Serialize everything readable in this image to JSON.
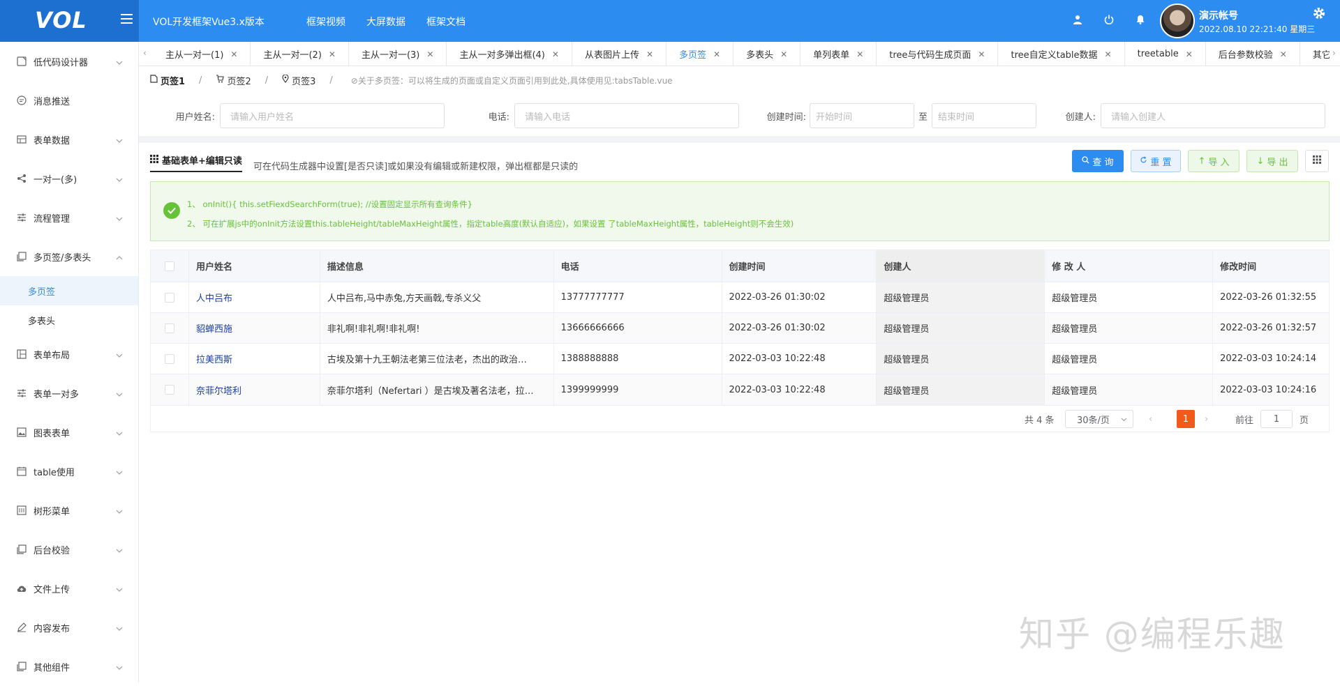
{
  "header": {
    "logo": "VOL",
    "app_title": "VOL开发框架Vue3.x版本",
    "nav": [
      "框架视频",
      "大屏数据",
      "框架文档"
    ],
    "user_name": "演示帐号",
    "user_date": "2022.08.10 22:21:40 星期三",
    "colors": {
      "primary": "#2d8cf0",
      "logo_bg": "#1d6fd0"
    }
  },
  "sidebar": {
    "items": [
      {
        "label": "低代码设计器",
        "icon": "form-icon"
      },
      {
        "label": "消息推送",
        "icon": "message-icon"
      },
      {
        "label": "表单数据",
        "icon": "table-icon"
      },
      {
        "label": "一对一(多)",
        "icon": "share-icon"
      },
      {
        "label": "流程管理",
        "icon": "sliders-icon"
      },
      {
        "label": "多页签/多表头",
        "icon": "copy-icon",
        "expanded": true,
        "children": [
          {
            "label": "多页签",
            "active": true
          },
          {
            "label": "多表头"
          }
        ]
      },
      {
        "label": "表单布局",
        "icon": "layout-icon"
      },
      {
        "label": "表单一对多",
        "icon": "sliders-icon"
      },
      {
        "label": "图表表单",
        "icon": "picture-icon"
      },
      {
        "label": "table使用",
        "icon": "calendar-icon"
      },
      {
        "label": "树形菜单",
        "icon": "tree-icon"
      },
      {
        "label": "后台校验",
        "icon": "copy-icon"
      },
      {
        "label": "文件上传",
        "icon": "upload-icon"
      },
      {
        "label": "内容发布",
        "icon": "edit-icon"
      },
      {
        "label": "其他组件",
        "icon": "copy-icon"
      }
    ]
  },
  "tabs": [
    {
      "label": "主从一对一(1)"
    },
    {
      "label": "主从一对一(2)"
    },
    {
      "label": "主从一对一(3)"
    },
    {
      "label": "主从一对多弹出框(4)"
    },
    {
      "label": "从表图片上传"
    },
    {
      "label": "多页签",
      "active": true
    },
    {
      "label": "多表头"
    },
    {
      "label": "单列表单"
    },
    {
      "label": "tree与代码生成页面"
    },
    {
      "label": "tree自定义table数据"
    },
    {
      "label": "treetable"
    },
    {
      "label": "后台参数校验"
    },
    {
      "label": "其它"
    }
  ],
  "subtabs": {
    "items": [
      "页签1",
      "页签2",
      "页签3"
    ],
    "separator": "/",
    "note": "⊘关于多页签：可以将生成的页面或自定义页面引用到此处,具体使用见:tabsTable.vue"
  },
  "search": {
    "user_label": "用户姓名:",
    "user_placeholder": "请输入用户姓名",
    "phone_label": "电话:",
    "phone_placeholder": "请输入电话",
    "created_label": "创建时间:",
    "start_placeholder": "开始时间",
    "to": "至",
    "end_placeholder": "结束时间",
    "creator_label": "创建人:",
    "creator_placeholder": "请输入创建人"
  },
  "toolbar": {
    "grid_title": "基础表单+编辑只读",
    "grid_desc": "可在代码生成器中设置[是否只读]或如果没有编辑或新建权限，弹出框都是只读的",
    "query": "查 询",
    "reset": "重 置",
    "import": "导 入",
    "export": "导 出"
  },
  "alert": {
    "line1": "1、 onInit(){ this.setFiexdSearchForm(true); //设置固定显示所有查询条件}",
    "line2": "2、 可在扩展js中的onInit方法设置this.tableHeight/tableMaxHeight属性，指定table高度(默认自适应)，如果设置 了tableMaxHeight属性，tableHeight则不会生效)"
  },
  "table": {
    "columns": [
      "用户姓名",
      "描述信息",
      "电话",
      "创建时间",
      "创建人",
      "修 改 人",
      "修改时间"
    ],
    "rows": [
      [
        "人中吕布",
        "人中吕布,马中赤兔,方天画戟,专杀义父",
        "13777777777",
        "2022-03-26 01:30:02",
        "超级管理员",
        "超级管理员",
        "2022-03-26 01:32:55"
      ],
      [
        "貂蝉西施",
        "非礼啊!非礼啊!非礼啊!",
        "13666666666",
        "2022-03-26 01:30:02",
        "超级管理员",
        "超级管理员",
        "2022-03-26 01:32:57"
      ],
      [
        "拉美西斯",
        "古埃及第十九王朝法老第三位法老，杰出的政治…",
        "1388888888",
        "2022-03-03 10:22:48",
        "超级管理员",
        "超级管理员",
        "2022-03-03 10:24:14"
      ],
      [
        "奈菲尔塔利",
        "奈菲尔塔利（Nefertari ）是古埃及著名法老，拉…",
        "1399999999",
        "2022-03-03 10:22:48",
        "超级管理员",
        "超级管理员",
        "2022-03-03 10:24:16"
      ]
    ]
  },
  "pagination": {
    "total": "共 4 条",
    "page_size": "30条/页",
    "current": "1",
    "goto_label": "前往",
    "goto_value": "1",
    "page_unit": "页"
  },
  "watermark": "知乎 @编程乐趣"
}
